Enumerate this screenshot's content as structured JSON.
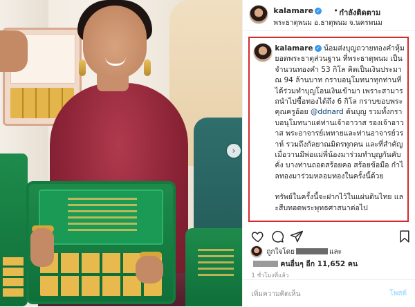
{
  "header": {
    "username": "kalamare",
    "follow_status": "กำลังติดตาม",
    "separator": "•",
    "location": "พระธาตุพนม อ.ธาตุพนม จ.นครพนม"
  },
  "caption": {
    "username": "kalamare",
    "text_part1": "น้อมส่งบุญถวายทองคำหุ้มยอดพระธาตุส่วนฐาน ที่พระธาตุพนม เป็นจำนวนทองคำ 53 กิโล คิดเป็นเงินประมาณ 94 ล้านบาท กราบอนุโมทนาทุกท่านที่ได้ร่วมทำบุญโอนเงินเข้ามา เพราะสามารถนำไปซื้อทองได้ถึง 6 กิโล กราบขอบพระคุณครูอ้อย ",
    "mention": "@ddnard",
    "text_part2": " ต้นบุญ รวมทั้งกราบอนุโมทนาแด่ท่านเจ้าอาวาส รองเจ้าอาวาส พระอาจารย์เพทายและท่านอาจารย์วราห์ รวมถึงกัลยาณมิตรทุกคน และที่สำคัญเมื่อวานมีพ่อแม่พี่น้องมาร่วมทำบุญกันคับคั่ง บางท่านถอดสร้อยคอ สร้อยข้อมือ กำไลทองมาร่วมหลอมทองในครั้งนี้ด้วย",
    "text_part3": "ทรัพย์ในครั้งนี้จะฝากไว้ในแผ่นดินไทย และสืบทอดพระพุทธศาสนาต่อไป"
  },
  "photo": {
    "carousel_next": "›"
  },
  "actions": {
    "icons": [
      "heart-icon",
      "comment-icon",
      "share-icon",
      "bookmark-icon"
    ]
  },
  "likes": {
    "liked_by_prefix": "ถูกใจโดย",
    "liked_by_suffix": "และ",
    "others_label": "คนอื่นๆ อีก 11,652 คน"
  },
  "time": "1 ชั่วโมงที่แล้ว",
  "comment": {
    "placeholder": "เพิ่มความคิดเห็น",
    "post_label": "โพสต์"
  },
  "colors": {
    "highlight_border": "#d42a2a",
    "verified_blue": "#3897f0",
    "post_disabled": "#b2dffc",
    "mention": "#003569"
  }
}
